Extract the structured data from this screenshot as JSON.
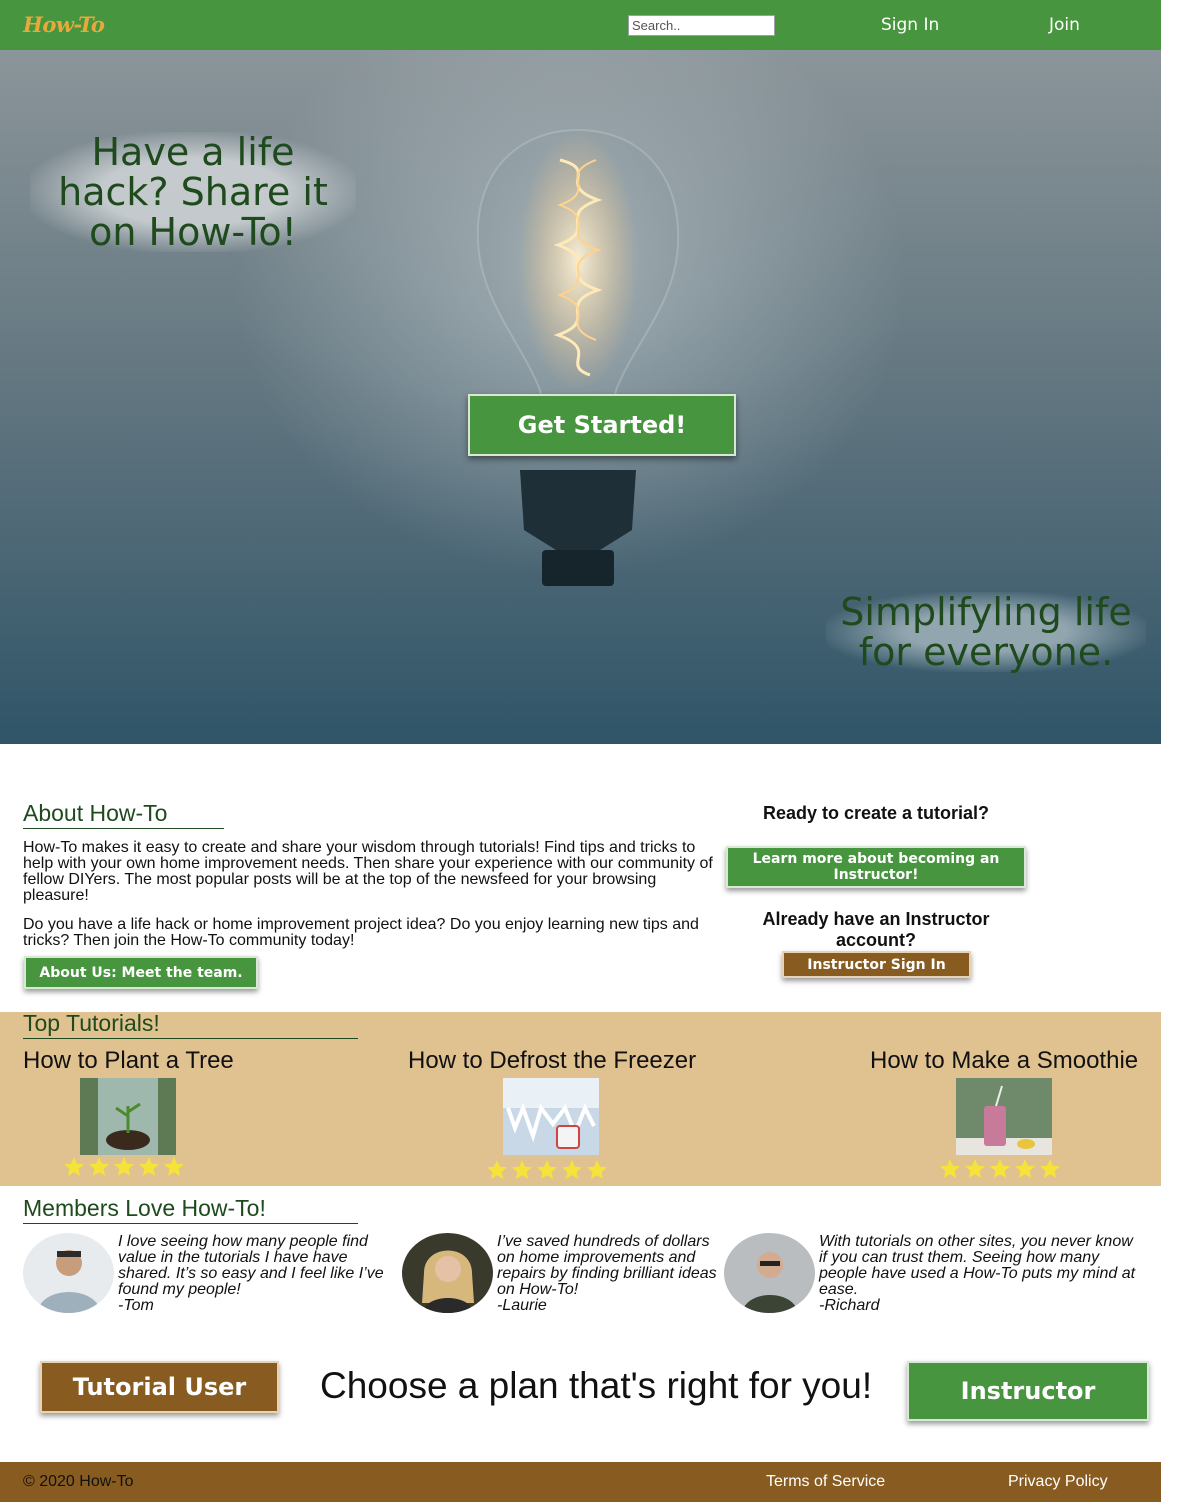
{
  "nav": {
    "logo": "How-To",
    "search_placeholder": "Search..",
    "sign_in": "Sign In",
    "join": "Join"
  },
  "hero": {
    "tagline_left": "Have a life hack? Share it on How-To!",
    "tagline_right": "Simplifyling life for everyone.",
    "cta": "Get Started!"
  },
  "about": {
    "title": "About How-To",
    "paragraph1": "How-To makes it easy to create and share your wisdom through tutorials! Find tips and tricks to help with your own home improvement needs. Then share your experience with our community of fellow DIYers. The most popular posts will be at the top of the newsfeed for your browsing pleasure!",
    "paragraph2": "Do you have a life hack or home improvement project idea? Do you enjoy learning new tips and tricks? Then join the How-To community today!",
    "team_button": "About Us: Meet the team."
  },
  "instructor_cta": {
    "question1": "Ready to create a tutorial?",
    "learn_button": "Learn more about becoming an Instructor!",
    "question2": "Already have an Instructor account?",
    "signin_button": "Instructor Sign In"
  },
  "tutorials": {
    "title": "Top Tutorials!",
    "items": [
      {
        "name": "How to Plant a Tree",
        "rating": 5
      },
      {
        "name": "How to Defrost the Freezer",
        "rating": 5
      },
      {
        "name": "How to Make a Smoothie",
        "rating": 5
      }
    ]
  },
  "testimonials": {
    "title": "Members Love How-To!",
    "items": [
      {
        "quote": "I love seeing how many people find value in the tutorials I have have shared. It’s so easy and I feel like I’ve found my people!",
        "author": "-Tom"
      },
      {
        "quote": "I’ve saved hundreds of dollars on home improvements and repairs by finding brilliant ideas on How-To!",
        "author": "-Laurie"
      },
      {
        "quote": "With tutorials on other sites, you never know if you can trust them. Seeing how many people have used a How-To puts my mind at ease.",
        "author": "-Richard"
      }
    ]
  },
  "plans": {
    "tutorial_user": "Tutorial User",
    "heading": "Choose a plan that's right for you!",
    "instructor": "Instructor"
  },
  "footer": {
    "copyright": "© 2020 How-To",
    "terms": "Terms of Service",
    "privacy": "Privacy Policy"
  },
  "colors": {
    "brand_green": "#47953f",
    "brand_brown": "#885c20",
    "tutorial_band": "#e0c190",
    "logo_orange": "#e6a93b",
    "heading_green": "#1f4a1d",
    "star_yellow": "#f5e23a"
  }
}
